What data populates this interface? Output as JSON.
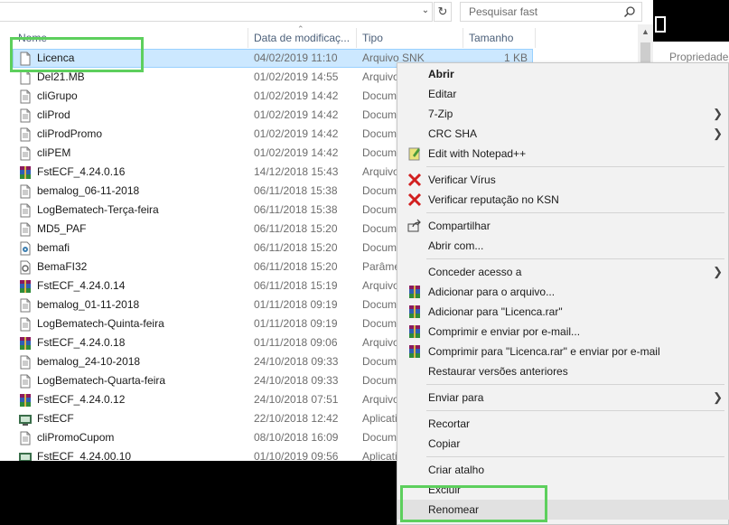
{
  "search": {
    "placeholder": "Pesquisar fast"
  },
  "columns": {
    "name": "Nome",
    "date": "Data de modificaç...",
    "type": "Tipo",
    "size": "Tamanho"
  },
  "files": [
    {
      "name": "Licenca",
      "date": "04/02/2019 11:10",
      "type": "Arquivo SNK",
      "size": "1 KB",
      "icon": "doc-icon",
      "selected": true
    },
    {
      "name": "Del21.MB",
      "date": "01/02/2019 14:55",
      "type": "Arquivo",
      "size": "",
      "icon": "doc-icon"
    },
    {
      "name": "cliGrupo",
      "date": "01/02/2019 14:42",
      "type": "Documento",
      "size": "",
      "icon": "text-doc-icon"
    },
    {
      "name": "cliProd",
      "date": "01/02/2019 14:42",
      "type": "Documento",
      "size": "",
      "icon": "text-doc-icon"
    },
    {
      "name": "cliProdPromo",
      "date": "01/02/2019 14:42",
      "type": "Documento",
      "size": "",
      "icon": "text-doc-icon"
    },
    {
      "name": "cliPEM",
      "date": "01/02/2019 14:42",
      "type": "Documento",
      "size": "",
      "icon": "text-doc-icon"
    },
    {
      "name": "FstECF_4.24.0.16",
      "date": "14/12/2018 15:43",
      "type": "Arquivo",
      "size": "",
      "icon": "winrar-icon"
    },
    {
      "name": "bemalog_06-11-2018",
      "date": "06/11/2018 15:38",
      "type": "Documento",
      "size": "",
      "icon": "text-doc-icon"
    },
    {
      "name": "LogBematech-Terça-feira",
      "date": "06/11/2018 15:38",
      "type": "Documento",
      "size": "",
      "icon": "text-doc-icon"
    },
    {
      "name": "MD5_PAF",
      "date": "06/11/2018 15:20",
      "type": "Documento",
      "size": "",
      "icon": "text-doc-icon"
    },
    {
      "name": "bemafi",
      "date": "06/11/2018 15:20",
      "type": "Documento",
      "size": "",
      "icon": "config-icon"
    },
    {
      "name": "BemaFI32",
      "date": "06/11/2018 15:20",
      "type": "Parâmetros",
      "size": "",
      "icon": "settings-file-icon"
    },
    {
      "name": "FstECF_4.24.0.14",
      "date": "06/11/2018 15:19",
      "type": "Arquivo",
      "size": "",
      "icon": "winrar-icon"
    },
    {
      "name": "bemalog_01-11-2018",
      "date": "01/11/2018 09:19",
      "type": "Documento",
      "size": "",
      "icon": "text-doc-icon"
    },
    {
      "name": "LogBematech-Quinta-feira",
      "date": "01/11/2018 09:19",
      "type": "Documento",
      "size": "",
      "icon": "text-doc-icon"
    },
    {
      "name": "FstECF_4.24.0.18",
      "date": "01/11/2018 09:06",
      "type": "Arquivo",
      "size": "",
      "icon": "winrar-icon"
    },
    {
      "name": "bemalog_24-10-2018",
      "date": "24/10/2018 09:33",
      "type": "Documento",
      "size": "",
      "icon": "text-doc-icon"
    },
    {
      "name": "LogBematech-Quarta-feira",
      "date": "24/10/2018 09:33",
      "type": "Documento",
      "size": "",
      "icon": "text-doc-icon"
    },
    {
      "name": "FstECF_4.24.0.12",
      "date": "24/10/2018 07:51",
      "type": "Arquivo",
      "size": "",
      "icon": "winrar-icon"
    },
    {
      "name": "FstECF",
      "date": "22/10/2018 12:42",
      "type": "Aplicativo",
      "size": "",
      "icon": "app-icon"
    },
    {
      "name": "cliPromoCupom",
      "date": "08/10/2018 16:09",
      "type": "Documento",
      "size": "",
      "icon": "text-doc-icon"
    },
    {
      "name": "FstECF_4.24.00.10",
      "date": "01/10/2019 09:56",
      "type": "Aplicativo",
      "size": "",
      "icon": "app-icon"
    }
  ],
  "right_panel": {
    "label": "Propriedades"
  },
  "context_menu": [
    {
      "label": "Abrir",
      "bold": true,
      "icon": ""
    },
    {
      "label": "Editar",
      "icon": ""
    },
    {
      "label": "7-Zip",
      "submenu": true,
      "icon": ""
    },
    {
      "label": "CRC SHA",
      "submenu": true,
      "icon": ""
    },
    {
      "label": "Edit with Notepad++",
      "icon": "notepad-plus-icon"
    },
    {
      "separator": true
    },
    {
      "label": "Verificar Vírus",
      "icon": "kaspersky-icon"
    },
    {
      "label": "Verificar reputação no KSN",
      "icon": "kaspersky-icon"
    },
    {
      "separator": true
    },
    {
      "label": "Compartilhar",
      "icon": "share-icon"
    },
    {
      "label": "Abrir com...",
      "icon": ""
    },
    {
      "separator": true
    },
    {
      "label": "Conceder acesso a",
      "submenu": true,
      "icon": ""
    },
    {
      "label": "Adicionar para o arquivo...",
      "icon": "winrar-icon"
    },
    {
      "label": "Adicionar para \"Licenca.rar\"",
      "icon": "winrar-icon"
    },
    {
      "label": "Comprimir e enviar por e-mail...",
      "icon": "winrar-icon"
    },
    {
      "label": "Comprimir para \"Licenca.rar\" e enviar por e-mail",
      "icon": "winrar-icon"
    },
    {
      "label": "Restaurar versões anteriores",
      "icon": ""
    },
    {
      "separator": true
    },
    {
      "label": "Enviar para",
      "submenu": true,
      "icon": ""
    },
    {
      "separator": true
    },
    {
      "label": "Recortar",
      "icon": ""
    },
    {
      "label": "Copiar",
      "icon": ""
    },
    {
      "separator": true
    },
    {
      "label": "Criar atalho",
      "icon": ""
    },
    {
      "label": "Excluir",
      "icon": ""
    },
    {
      "label": "Renomear",
      "icon": "",
      "hover": true
    }
  ],
  "colors": {
    "selection": "#cce8ff",
    "highlight": "#5dcf5d",
    "menu_bg": "#f2f2f2",
    "header_text": "#4c607a"
  }
}
